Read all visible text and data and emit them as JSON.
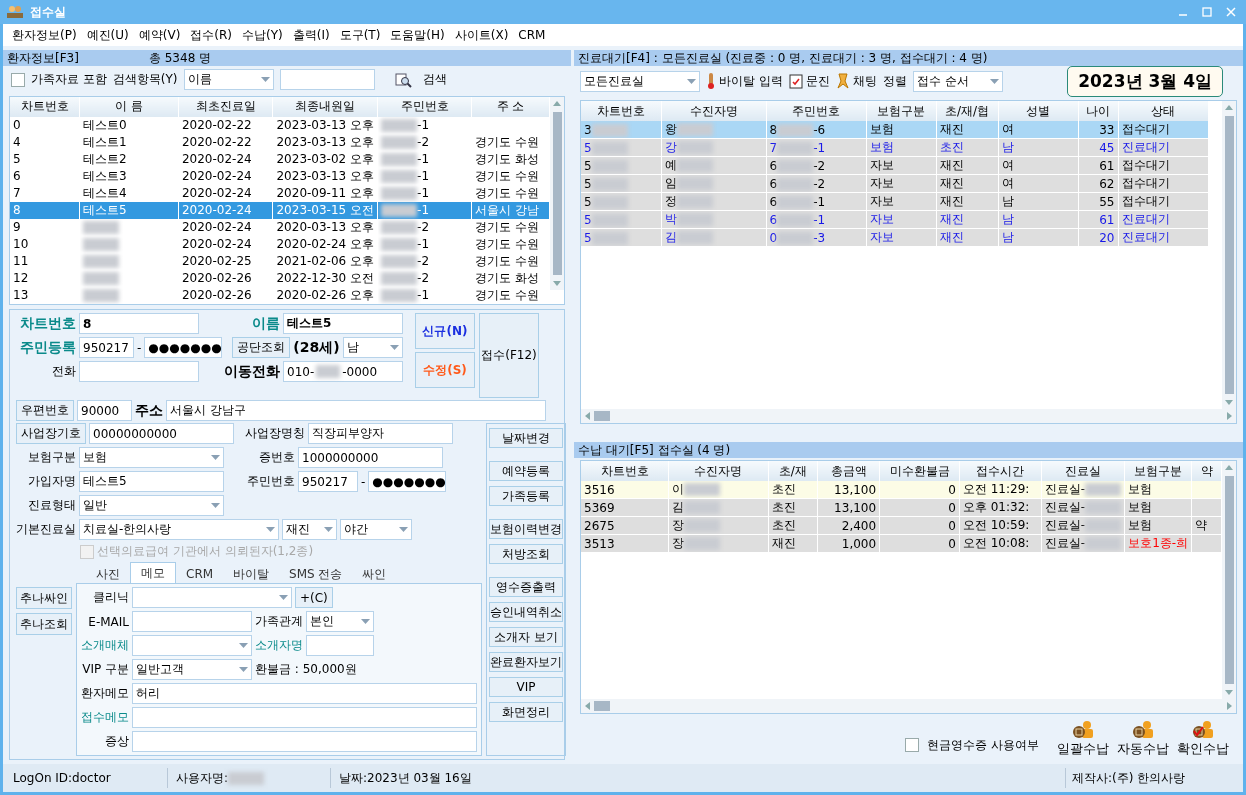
{
  "window": {
    "title": "접수실"
  },
  "menu": [
    "환자정보(P)",
    "예진(U)",
    "예약(V)",
    "접수(R)",
    "수납(Y)",
    "출력(I)",
    "도구(T)",
    "도움말(H)",
    "사이트(X)",
    "CRM"
  ],
  "patients": {
    "header": "환자정보[F3]",
    "total": "총 5348 명",
    "family_check": {
      "label": "가족자료 포함",
      "checked": false
    },
    "search_label": "검색항목(Y)",
    "search_field": "이름",
    "search_button": "검색",
    "columns": [
      "차트번호",
      "이 름",
      "최초진료일",
      "최종내원일",
      "주민번호",
      "주 소"
    ],
    "rows": [
      {
        "selected": false,
        "cells": [
          "0",
          "테스트0",
          "2020-02-22",
          "2023-03-13 오후",
          {
            "post": "-1"
          },
          ""
        ]
      },
      {
        "selected": false,
        "cells": [
          "4",
          "테스트1",
          "2020-02-22",
          "2023-03-13 오후",
          {
            "post": "-2"
          },
          "경기도 수원"
        ]
      },
      {
        "selected": false,
        "cells": [
          "5",
          "테스트2",
          "2020-02-24",
          "2023-03-02 오후",
          {
            "post": "-1"
          },
          "경기도 화성"
        ]
      },
      {
        "selected": false,
        "cells": [
          "6",
          "테스트3",
          "2020-02-24",
          "2023-03-13 오후",
          {
            "post": "-1"
          },
          "경기도 수원"
        ]
      },
      {
        "selected": false,
        "cells": [
          "7",
          "테스트4",
          "2020-02-24",
          "2020-09-11 오후",
          {
            "post": "-1"
          },
          "경기도 수원"
        ]
      },
      {
        "selected": true,
        "cells": [
          "8",
          "테스트5",
          "2020-02-24",
          "2023-03-15 오전",
          {
            "post": "-1"
          },
          "서울시 강남"
        ]
      },
      {
        "selected": false,
        "cells": [
          "9",
          {
            "blurred": true
          },
          "2020-02-24",
          "2020-03-13 오후",
          {
            "post": "-2"
          },
          "경기도 수원"
        ]
      },
      {
        "selected": false,
        "cells": [
          "10",
          {
            "blurred": true
          },
          "2020-02-24",
          "2020-02-24 오후",
          {
            "post": "-1"
          },
          "경기도 수원"
        ]
      },
      {
        "selected": false,
        "cells": [
          "11",
          {
            "blurred": true
          },
          "2020-02-25",
          "2021-02-06 오후",
          {
            "post": "-2"
          },
          "경기도 수원"
        ]
      },
      {
        "selected": false,
        "cells": [
          "12",
          {
            "blurred": true
          },
          "2020-02-26",
          "2022-12-30 오전",
          {
            "post": "-2"
          },
          "경기도 화성"
        ]
      },
      {
        "selected": false,
        "cells": [
          "13",
          {
            "blurred": true
          },
          "2020-02-26",
          "2020-02-26 오후",
          {
            "post": "-1"
          },
          "경기도 수원"
        ]
      }
    ]
  },
  "form": {
    "chart_no": {
      "label": "차트번호",
      "value": "8"
    },
    "name": {
      "label": "이름",
      "value": "테스트5"
    },
    "new_button": "신규(N)",
    "edit_button": "수정(S)",
    "register_button": "접수(F12)",
    "rrn": {
      "label": "주민등록",
      "front": "950217",
      "separator": "-",
      "back": "●●●●●●●"
    },
    "nhis_button": "공단조회",
    "age": "(28세)",
    "sex": "남",
    "phone": {
      "label": "전화"
    },
    "mobile": {
      "label": "이동전화",
      "pre": "010-",
      "post": "-0000"
    },
    "zip_button": "우편번호",
    "zip": "90000",
    "address_label": "주소",
    "address": "서울시 강남구",
    "workplace_button": "사업장기호",
    "workplace_code": "00000000000",
    "workplace_name": {
      "label": "사업장명칭",
      "value": "직장피부양자"
    },
    "insurance": {
      "label": "보험구분",
      "value": "보험"
    },
    "card_no": {
      "label": "증번호",
      "value": "1000000000"
    },
    "subscriber": {
      "label": "가입자명",
      "value": "테스트5"
    },
    "subscriber_rrn": {
      "label": "주민번호",
      "front": "950217",
      "separator": "-",
      "back": "●●●●●●●"
    },
    "care_type": {
      "label": "진료형태",
      "value": "일반"
    },
    "room": {
      "label": "기본진료실",
      "value": "치료실-한의사랑",
      "visit": "재진",
      "time": "야간"
    },
    "referral": {
      "label": "선택의료급여 기관에서 의뢰된자(1,2종)",
      "checked": false,
      "disabled": true
    },
    "side_buttons": [
      "날짜변경",
      "예약등록",
      "가족등록",
      "보험이력변경",
      "처방조회",
      "영수증출력",
      "승인내역취소",
      "소개자 보기",
      "완료환자보기",
      "VIP",
      "화면정리"
    ],
    "chuna_buttons": [
      "추나싸인",
      "추나조회"
    ],
    "tabs": [
      {
        "label": "사진",
        "selected": false
      },
      {
        "label": "메모",
        "selected": true
      },
      {
        "label": "CRM",
        "selected": false
      },
      {
        "label": "바이탈",
        "selected": false
      },
      {
        "label": "SMS 전송",
        "selected": false
      },
      {
        "label": "싸인",
        "selected": false
      }
    ],
    "memo": {
      "clinic": {
        "label": "클리닉"
      },
      "clinic_add": "+(C)",
      "email": {
        "label": "E-MAIL"
      },
      "relation": {
        "label": "가족관계",
        "value": "본인"
      },
      "referral_media": {
        "label": "소개매체"
      },
      "referrer": {
        "label": "소개자명"
      },
      "vip": {
        "label": "VIP 구분",
        "value": "일반고객"
      },
      "refund": "환불금 : 50,000원",
      "patient_memo": {
        "label": "환자메모",
        "value": "허리"
      },
      "reception_memo": {
        "label": "접수메모"
      },
      "symptom": {
        "label": "증상"
      }
    }
  },
  "waiting": {
    "header": "진료대기[F4] : 모든진료실 (진료중 : 0 명, 진료대기 : 3 명, 접수대기 : 4 명)",
    "room_select": "모든진료실",
    "vital_button": "바이탈 입력",
    "questionnaire_button": "문진",
    "chat_button": "채팅",
    "sort_label": "정렬",
    "sort_select": "접수 순서",
    "date": "2023년 3월 4일",
    "columns": [
      "차트번호",
      "수진자명",
      "주민번호",
      "보험구분",
      "초/재/협",
      "성별",
      "나이",
      "상태"
    ],
    "rows": [
      {
        "selected": true,
        "kind": "reception",
        "cells": [
          {
            "pre": "3"
          },
          {
            "pre": "왕"
          },
          {
            "pre": "8",
            "post": "-6"
          },
          "보험",
          "재진",
          "여",
          "33",
          "접수대기"
        ]
      },
      {
        "selected": false,
        "kind": "care",
        "cells": [
          {
            "pre": "5"
          },
          {
            "pre": "강"
          },
          {
            "pre": "7",
            "post": "-1"
          },
          "보험",
          "초진",
          "남",
          "45",
          "진료대기"
        ]
      },
      {
        "selected": false,
        "kind": "reception",
        "cells": [
          {
            "pre": "5"
          },
          {
            "pre": "예"
          },
          {
            "pre": "6",
            "post": "-2"
          },
          "자보",
          "재진",
          "여",
          "61",
          "접수대기"
        ]
      },
      {
        "selected": false,
        "kind": "reception",
        "cells": [
          {
            "pre": "5"
          },
          {
            "pre": "임"
          },
          {
            "pre": "6",
            "post": "-2"
          },
          "자보",
          "재진",
          "여",
          "62",
          "접수대기"
        ]
      },
      {
        "selected": false,
        "kind": "reception",
        "cells": [
          {
            "pre": "5"
          },
          {
            "pre": "정"
          },
          {
            "pre": "6",
            "post": "-1"
          },
          "자보",
          "재진",
          "남",
          "55",
          "접수대기"
        ]
      },
      {
        "selected": false,
        "kind": "care",
        "cells": [
          {
            "pre": "5"
          },
          {
            "pre": "박"
          },
          {
            "pre": "6",
            "post": "-1"
          },
          "자보",
          "재진",
          "남",
          "61",
          "진료대기"
        ]
      },
      {
        "selected": false,
        "kind": "care",
        "cells": [
          {
            "pre": "5"
          },
          {
            "pre": "김"
          },
          {
            "pre": "0",
            "post": "-3"
          },
          "자보",
          "재진",
          "남",
          "20",
          "진료대기"
        ]
      }
    ]
  },
  "payment": {
    "header": "수납 대기[F5] 접수실 (4 명)",
    "columns": [
      "차트번호",
      "수진자명",
      "초/재",
      "총금액",
      "미수환불금",
      "접수시간",
      "진료실",
      "보험구분",
      "약"
    ],
    "rows": [
      {
        "selected": true,
        "cells": [
          "3516",
          {
            "pre": "이"
          },
          "초진",
          "13,100",
          "0",
          "오전 11:29:",
          {
            "pre": "진료실-"
          },
          "보험",
          ""
        ]
      },
      {
        "selected": false,
        "cells": [
          "5369",
          {
            "pre": "김"
          },
          "초진",
          "13,100",
          "0",
          "오후 01:32:",
          {
            "pre": "진료실-"
          },
          "보험",
          ""
        ]
      },
      {
        "selected": false,
        "cells": [
          "2675",
          {
            "pre": "장"
          },
          "초진",
          "2,400",
          "0",
          "오전 10:59:",
          {
            "pre": "진료실-"
          },
          "보험",
          "약"
        ]
      },
      {
        "selected": false,
        "cells": [
          "3513",
          {
            "pre": "장"
          },
          "재진",
          "1,000",
          "0",
          "오전 10:08:",
          {
            "pre": "진료실-"
          },
          {
            "text": "보호1종-희",
            "color": "#ff0000"
          },
          ""
        ]
      }
    ],
    "cash_receipt": {
      "label": "현금영수증 사용여부",
      "checked": false
    },
    "actions": [
      "일괄수납",
      "자동수납",
      "확인수납"
    ]
  },
  "status_bar": {
    "logon": "LogOn ID:doctor",
    "user_label": "사용자명:",
    "date": "날짜:2023년 03월 16일",
    "maker": "제작사:(주) 한의사랑"
  }
}
